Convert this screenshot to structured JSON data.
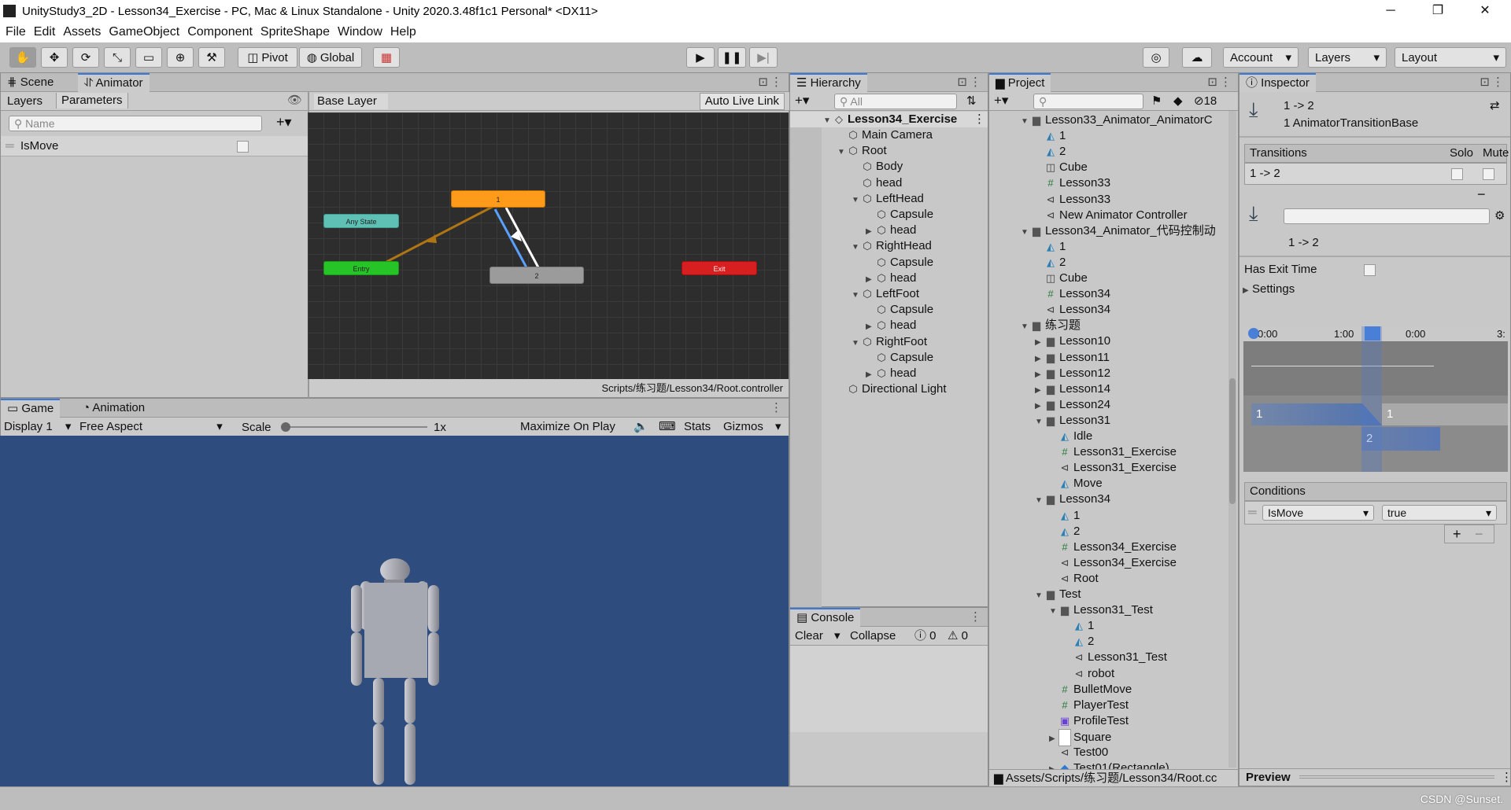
{
  "window": {
    "title": "UnityStudy3_2D - Lesson34_Exercise - PC, Mac & Linux Standalone - Unity 2020.3.48f1c1 Personal* <DX11>",
    "minimize": "─",
    "maximize": "❐",
    "close": "✕"
  },
  "menu": [
    "File",
    "Edit",
    "Assets",
    "GameObject",
    "Component",
    "SpriteShape",
    "Window",
    "Help"
  ],
  "toolbar": {
    "pivot": "Pivot",
    "global": "Global",
    "account": "Account",
    "layers": "Layers",
    "layout": "Layout"
  },
  "animator": {
    "tab_scene": "Scene",
    "tab_animator": "Animator",
    "layers_tab": "Layers",
    "parameters_tab": "Parameters",
    "search_placeholder": "Name",
    "param_name": "IsMove",
    "base_layer": "Base Layer",
    "auto_live_link": "Auto Live Link",
    "path": "Scripts/练习题/Lesson34/Root.controller",
    "nodes": {
      "state1": "1",
      "state2": "2",
      "any_state": "Any State",
      "entry": "Entry",
      "exit": "Exit"
    }
  },
  "game": {
    "tab_game": "Game",
    "tab_animation": "Animation",
    "display": "Display 1",
    "aspect": "Free Aspect",
    "scale_label": "Scale",
    "scale_value": "1x",
    "maximize": "Maximize On Play",
    "stats": "Stats",
    "gizmos": "Gizmos"
  },
  "hierarchy": {
    "title": "Hierarchy",
    "search": "All",
    "scene": "Lesson34_Exercise",
    "items": [
      {
        "label": "Main Camera",
        "depth": 1,
        "arrow": ""
      },
      {
        "label": "Root",
        "depth": 1,
        "arrow": "▼"
      },
      {
        "label": "Body",
        "depth": 2,
        "arrow": ""
      },
      {
        "label": "head",
        "depth": 2,
        "arrow": ""
      },
      {
        "label": "LeftHead",
        "depth": 2,
        "arrow": "▼"
      },
      {
        "label": "Capsule",
        "depth": 3,
        "arrow": ""
      },
      {
        "label": "head",
        "depth": 3,
        "arrow": "▶"
      },
      {
        "label": "RightHead",
        "depth": 2,
        "arrow": "▼"
      },
      {
        "label": "Capsule",
        "depth": 3,
        "arrow": ""
      },
      {
        "label": "head",
        "depth": 3,
        "arrow": "▶"
      },
      {
        "label": "LeftFoot",
        "depth": 2,
        "arrow": "▼"
      },
      {
        "label": "Capsule",
        "depth": 3,
        "arrow": ""
      },
      {
        "label": "head",
        "depth": 3,
        "arrow": "▶"
      },
      {
        "label": "RightFoot",
        "depth": 2,
        "arrow": "▼"
      },
      {
        "label": "Capsule",
        "depth": 3,
        "arrow": ""
      },
      {
        "label": "head",
        "depth": 3,
        "arrow": "▶"
      },
      {
        "label": "Directional Light",
        "depth": 1,
        "arrow": ""
      }
    ]
  },
  "console": {
    "title": "Console",
    "clear": "Clear",
    "collapse": "Collapse",
    "errors": "0",
    "warnings": "0"
  },
  "project": {
    "title": "Project",
    "hidden_count": "18",
    "footer": "Assets/Scripts/练习题/Lesson34/Root.cc",
    "items": [
      {
        "label": "Lesson33_Animator_AnimatorC",
        "depth": 0,
        "arrow": "▼",
        "icon": "folder"
      },
      {
        "label": "1",
        "depth": 1,
        "arrow": "",
        "icon": "anim"
      },
      {
        "label": "2",
        "depth": 1,
        "arrow": "",
        "icon": "anim"
      },
      {
        "label": "Cube",
        "depth": 1,
        "arrow": "",
        "icon": "prefab"
      },
      {
        "label": "Lesson33",
        "depth": 1,
        "arrow": "",
        "icon": "script"
      },
      {
        "label": "Lesson33",
        "depth": 1,
        "arrow": "",
        "icon": "controller"
      },
      {
        "label": "New Animator Controller",
        "depth": 1,
        "arrow": "",
        "icon": "controller"
      },
      {
        "label": "Lesson34_Animator_代码控制动",
        "depth": 0,
        "arrow": "▼",
        "icon": "folder"
      },
      {
        "label": "1",
        "depth": 1,
        "arrow": "",
        "icon": "anim"
      },
      {
        "label": "2",
        "depth": 1,
        "arrow": "",
        "icon": "anim"
      },
      {
        "label": "Cube",
        "depth": 1,
        "arrow": "",
        "icon": "prefab"
      },
      {
        "label": "Lesson34",
        "depth": 1,
        "arrow": "",
        "icon": "script"
      },
      {
        "label": "Lesson34",
        "depth": 1,
        "arrow": "",
        "icon": "controller"
      },
      {
        "label": "练习题",
        "depth": 0,
        "arrow": "▼",
        "icon": "folder"
      },
      {
        "label": "Lesson10",
        "depth": 1,
        "arrow": "▶",
        "icon": "folder"
      },
      {
        "label": "Lesson11",
        "depth": 1,
        "arrow": "▶",
        "icon": "folder"
      },
      {
        "label": "Lesson12",
        "depth": 1,
        "arrow": "▶",
        "icon": "folder"
      },
      {
        "label": "Lesson14",
        "depth": 1,
        "arrow": "▶",
        "icon": "folder"
      },
      {
        "label": "Lesson24",
        "depth": 1,
        "arrow": "▶",
        "icon": "folder"
      },
      {
        "label": "Lesson31",
        "depth": 1,
        "arrow": "▼",
        "icon": "folder"
      },
      {
        "label": "Idle",
        "depth": 2,
        "arrow": "",
        "icon": "anim"
      },
      {
        "label": "Lesson31_Exercise",
        "depth": 2,
        "arrow": "",
        "icon": "script"
      },
      {
        "label": "Lesson31_Exercise",
        "depth": 2,
        "arrow": "",
        "icon": "controller"
      },
      {
        "label": "Move",
        "depth": 2,
        "arrow": "",
        "icon": "anim"
      },
      {
        "label": "Lesson34",
        "depth": 1,
        "arrow": "▼",
        "icon": "folder"
      },
      {
        "label": "1",
        "depth": 2,
        "arrow": "",
        "icon": "anim"
      },
      {
        "label": "2",
        "depth": 2,
        "arrow": "",
        "icon": "anim"
      },
      {
        "label": "Lesson34_Exercise",
        "depth": 2,
        "arrow": "",
        "icon": "script"
      },
      {
        "label": "Lesson34_Exercise",
        "depth": 2,
        "arrow": "",
        "icon": "controller"
      },
      {
        "label": "Root",
        "depth": 2,
        "arrow": "",
        "icon": "controller"
      },
      {
        "label": "Test",
        "depth": 1,
        "arrow": "▼",
        "icon": "folder"
      },
      {
        "label": "Lesson31_Test",
        "depth": 2,
        "arrow": "▼",
        "icon": "folder"
      },
      {
        "label": "1",
        "depth": 3,
        "arrow": "",
        "icon": "anim"
      },
      {
        "label": "2",
        "depth": 3,
        "arrow": "",
        "icon": "anim"
      },
      {
        "label": "Lesson31_Test",
        "depth": 3,
        "arrow": "",
        "icon": "controller"
      },
      {
        "label": "robot",
        "depth": 3,
        "arrow": "",
        "icon": "controller"
      },
      {
        "label": "BulletMove",
        "depth": 2,
        "arrow": "",
        "icon": "script"
      },
      {
        "label": "PlayerTest",
        "depth": 2,
        "arrow": "",
        "icon": "script"
      },
      {
        "label": "ProfileTest",
        "depth": 2,
        "arrow": "",
        "icon": "profile"
      },
      {
        "label": "Square",
        "depth": 2,
        "arrow": "▶",
        "icon": "sprite"
      },
      {
        "label": "Test00",
        "depth": 2,
        "arrow": "",
        "icon": "controller"
      },
      {
        "label": "Test01(Rectangle)",
        "depth": 2,
        "arrow": "▶",
        "icon": "model"
      }
    ]
  },
  "inspector": {
    "title": "Inspector",
    "header_title": "1 -> 2",
    "header_subtitle": "1 AnimatorTransitionBase",
    "transitions_label": "Transitions",
    "solo": "Solo",
    "mute": "Mute",
    "transition_row": "1 -> 2",
    "transition_name": "1 -> 2",
    "has_exit_time": "Has Exit Time",
    "settings": "Settings",
    "ticks": [
      "0:00",
      "1:00",
      "0:00",
      "3:"
    ],
    "clip_a": "1",
    "clip_b": "1",
    "clip_c": "2",
    "conditions": "Conditions",
    "cond_param": "IsMove",
    "cond_value": "true",
    "preview": "Preview"
  },
  "watermark": "CSDN @Sunset.",
  "colors": {
    "accent": "#3a79d8",
    "state_orange": "#ff9b1a",
    "any_state": "#5fc1b5",
    "entry": "#27c427",
    "exit": "#d81f1f",
    "scene_bg": "#2e4d7e"
  }
}
